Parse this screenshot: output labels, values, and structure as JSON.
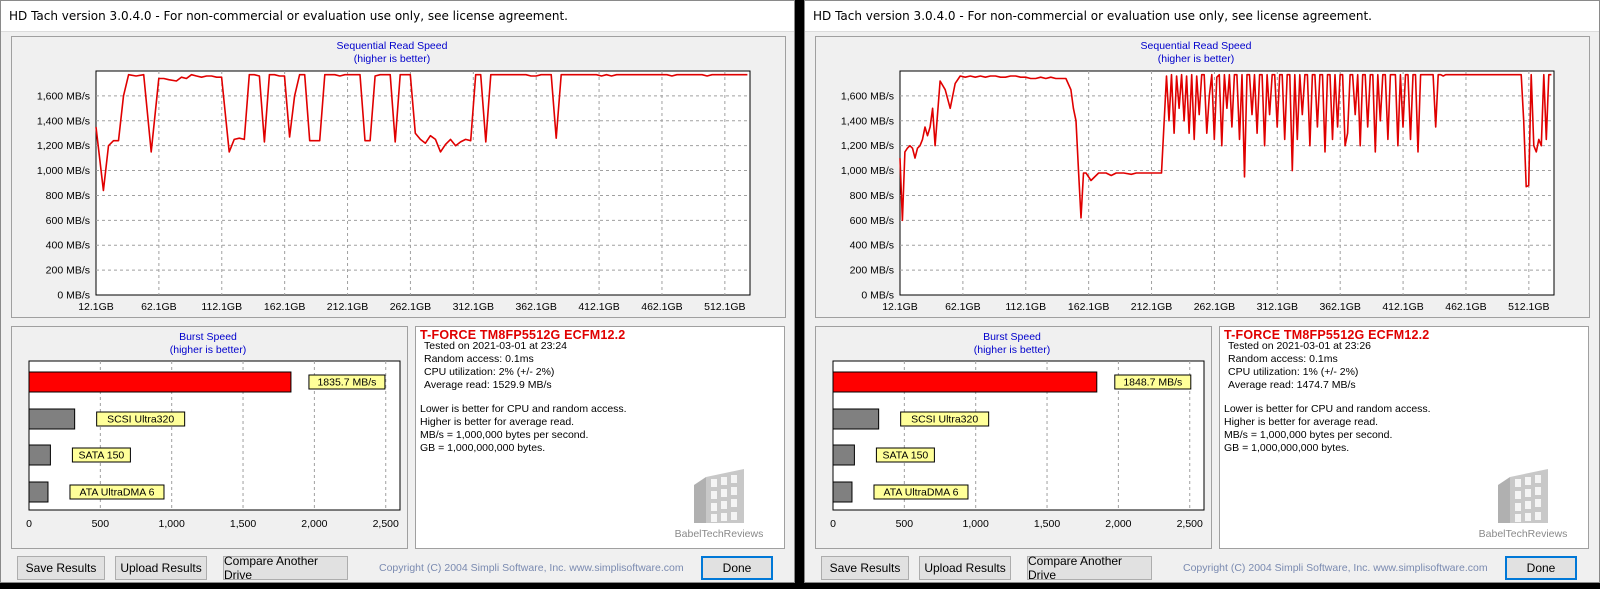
{
  "windows": [
    {
      "title": "HD Tach version 3.0.4.0  - For non-commercial or evaluation use only, see license agreement.",
      "seq": {
        "title": "Sequential Read Speed",
        "subtitle": "(higher is better)",
        "y_ticks": [
          "0 MB/s",
          "200 MB/s",
          "400 MB/s",
          "600 MB/s",
          "800 MB/s",
          "1,000 MB/s",
          "1,200 MB/s",
          "1,400 MB/s",
          "1,600 MB/s"
        ],
        "x_ticks": [
          "12.1GB",
          "62.1GB",
          "112.1GB",
          "162.1GB",
          "212.1GB",
          "262.1GB",
          "312.1GB",
          "362.1GB",
          "412.1GB",
          "462.1GB",
          "512.1GB"
        ]
      },
      "burst": {
        "title": "Burst Speed",
        "subtitle": "(higher is better)",
        "x_ticks": [
          "0",
          "500",
          "1,000",
          "1,500",
          "2,000",
          "2,500"
        ],
        "drive_label": "1835.7 MB/s",
        "ref_labels": [
          "SCSI Ultra320",
          "SATA 150",
          "ATA UltraDMA 6"
        ]
      },
      "info": {
        "drive_name": "T-FORCE TM8FP5512G ECFM12.2",
        "tested": "Tested on 2021-03-01 at 23:24",
        "random": "Random access: 0.1ms",
        "cpu": "CPU utilization: 2% (+/- 2%)",
        "avg": "Average read: 1529.9 MB/s",
        "note1": "Lower is better for CPU and random access.",
        "note2": "Higher is better for average read.",
        "note3": "MB/s = 1,000,000 bytes per second.",
        "note4": "GB = 1,000,000,000 bytes.",
        "watermark": "BabelTechReviews"
      },
      "buttons": {
        "save": "Save Results",
        "upload": "Upload Results",
        "compare": "Compare Another Drive",
        "done": "Done"
      },
      "copyright": "Copyright (C) 2004 Simpli Software, Inc. www.simplisoftware.com"
    },
    {
      "title": "HD Tach version 3.0.4.0  - For non-commercial or evaluation use only, see license agreement.",
      "seq": {
        "title": "Sequential Read Speed",
        "subtitle": "(higher is better)",
        "y_ticks": [
          "0 MB/s",
          "200 MB/s",
          "400 MB/s",
          "600 MB/s",
          "800 MB/s",
          "1,000 MB/s",
          "1,200 MB/s",
          "1,400 MB/s",
          "1,600 MB/s"
        ],
        "x_ticks": [
          "12.1GB",
          "62.1GB",
          "112.1GB",
          "162.1GB",
          "212.1GB",
          "262.1GB",
          "312.1GB",
          "362.1GB",
          "412.1GB",
          "462.1GB",
          "512.1GB"
        ]
      },
      "burst": {
        "title": "Burst Speed",
        "subtitle": "(higher is better)",
        "x_ticks": [
          "0",
          "500",
          "1,000",
          "1,500",
          "2,000",
          "2,500"
        ],
        "drive_label": "1848.7 MB/s",
        "ref_labels": [
          "SCSI Ultra320",
          "SATA 150",
          "ATA UltraDMA 6"
        ]
      },
      "info": {
        "drive_name": "T-FORCE TM8FP5512G ECFM12.2",
        "tested": "Tested on 2021-03-01 at 23:26",
        "random": "Random access: 0.1ms",
        "cpu": "CPU utilization: 1% (+/- 2%)",
        "avg": "Average read: 1474.7 MB/s",
        "note1": "Lower is better for CPU and random access.",
        "note2": "Higher is better for average read.",
        "note3": "MB/s = 1,000,000 bytes per second.",
        "note4": "GB = 1,000,000,000 bytes.",
        "watermark": "BabelTechReviews"
      },
      "buttons": {
        "save": "Save Results",
        "upload": "Upload Results",
        "compare": "Compare Another Drive",
        "done": "Done"
      },
      "copyright": "Copyright (C) 2004 Simpli Software, Inc. www.simplisoftware.com"
    }
  ],
  "colors": {
    "series": "#e00000",
    "burst_drive": "#ff0000",
    "burst_ref": "#808080",
    "label_fill": "#ffff99",
    "chart_title": "#0000cc",
    "grid": "#a0a0a0"
  },
  "chart_data": [
    {
      "type": "line",
      "title": "Sequential Read Speed",
      "subtitle": "(higher is better)",
      "xlabel": "",
      "ylabel": "",
      "xlim": [
        12.1,
        532.1
      ],
      "ylim": [
        0,
        1800
      ],
      "y_unit": "MB/s",
      "x_unit": "GB",
      "grid": true,
      "series": [
        {
          "x": [
            12.1,
            18,
            22,
            26,
            30,
            34,
            38,
            44,
            50,
            56,
            62,
            66,
            70,
            76,
            80,
            84,
            88,
            92,
            96,
            100,
            104,
            108,
            112,
            118,
            122,
            126,
            130,
            134,
            138,
            142,
            146,
            150,
            154,
            158,
            162,
            166,
            170,
            174,
            178,
            182,
            186,
            190,
            194,
            198,
            202,
            206,
            210,
            214,
            218,
            222,
            226,
            230,
            234,
            238,
            242,
            246,
            250,
            254,
            258,
            262,
            266,
            270,
            274,
            278,
            282,
            286,
            290,
            294,
            298,
            302,
            306,
            310,
            314,
            318,
            322,
            326,
            330,
            334,
            338,
            342,
            346,
            350,
            354,
            358,
            362,
            366,
            370,
            374,
            378,
            382,
            386,
            390,
            394,
            398,
            402,
            406,
            410,
            414,
            418,
            422,
            426,
            430,
            434,
            438,
            442,
            446,
            450,
            454,
            458,
            462,
            466,
            470,
            474,
            478,
            482,
            486,
            490,
            494,
            498,
            502,
            506,
            510,
            514,
            518,
            522,
            526,
            530
          ],
          "y": [
            1350,
            840,
            1200,
            1240,
            1240,
            1600,
            1770,
            1760,
            1770,
            1150,
            1740,
            1740,
            1730,
            1720,
            1750,
            1740,
            1770,
            1760,
            1750,
            1760,
            1760,
            1750,
            1750,
            1150,
            1250,
            1260,
            1250,
            1770,
            1770,
            1760,
            1230,
            1770,
            1770,
            1760,
            1760,
            1270,
            1600,
            1770,
            1770,
            1240,
            1240,
            1240,
            1770,
            1770,
            1770,
            1760,
            1770,
            1770,
            1770,
            1770,
            1240,
            1240,
            1760,
            1770,
            1770,
            1770,
            1230,
            1770,
            1770,
            1770,
            1300,
            1250,
            1220,
            1280,
            1250,
            1150,
            1210,
            1250,
            1200,
            1230,
            1250,
            1240,
            1770,
            1770,
            1230,
            1770,
            1770,
            1770,
            1770,
            1770,
            1770,
            1770,
            1770,
            1760,
            1760,
            1770,
            1770,
            1770,
            1260,
            1770,
            1770,
            1770,
            1770,
            1770,
            1770,
            1770,
            1770,
            1760,
            1770,
            1760,
            1770,
            1770,
            1770,
            1770,
            1770,
            1770,
            1770,
            1770,
            1770,
            1770,
            1770,
            1760,
            1770,
            1770,
            1770,
            1770,
            1770,
            1770,
            1760,
            1770,
            1770,
            1770,
            1770,
            1770,
            1770,
            1770,
            1770
          ]
        }
      ]
    },
    {
      "type": "bar",
      "title": "Burst Speed",
      "subtitle": "(higher is better)",
      "categories": [
        "T-FORCE TM8FP5512G",
        "SCSI Ultra320",
        "SATA 150",
        "ATA UltraDMA 6"
      ],
      "values": [
        1835.7,
        320,
        150,
        133
      ],
      "xlim": [
        0,
        2600
      ],
      "orientation": "horizontal"
    },
    {
      "type": "line",
      "title": "Sequential Read Speed",
      "subtitle": "(higher is better)",
      "xlabel": "",
      "ylabel": "",
      "xlim": [
        12.1,
        532.1
      ],
      "ylim": [
        0,
        1800
      ],
      "y_unit": "MB/s",
      "x_unit": "GB",
      "grid": true,
      "series": [
        {
          "x": [
            12.1,
            14,
            16,
            18,
            20,
            22,
            24,
            26,
            28,
            30,
            32,
            34,
            36,
            38,
            40,
            44,
            48,
            52,
            56,
            60,
            64,
            68,
            72,
            76,
            80,
            84,
            88,
            92,
            96,
            100,
            104,
            108,
            112,
            116,
            120,
            124,
            128,
            132,
            136,
            140,
            144,
            148,
            150,
            152,
            154,
            156,
            158,
            160,
            164,
            170,
            176,
            180,
            184,
            190,
            196,
            200,
            206,
            212,
            216,
            220,
            224,
            226,
            228,
            230,
            232,
            234,
            236,
            238,
            240,
            242,
            244,
            246,
            248,
            250,
            252,
            254,
            256,
            258,
            260,
            262,
            264,
            266,
            268,
            270,
            272,
            274,
            276,
            278,
            280,
            282,
            284,
            286,
            288,
            290,
            292,
            294,
            296,
            298,
            300,
            302,
            304,
            306,
            308,
            310,
            312,
            314,
            316,
            318,
            320,
            322,
            324,
            326,
            328,
            330,
            332,
            334,
            336,
            338,
            340,
            342,
            344,
            346,
            348,
            350,
            352,
            354,
            356,
            358,
            360,
            362,
            364,
            366,
            368,
            370,
            372,
            374,
            376,
            378,
            380,
            382,
            384,
            386,
            388,
            390,
            392,
            394,
            396,
            398,
            400,
            402,
            404,
            406,
            408,
            410,
            412,
            414,
            416,
            418,
            420,
            422,
            424,
            426,
            428,
            430,
            432,
            434,
            436,
            438,
            440,
            442,
            444,
            446,
            448,
            450,
            452,
            454,
            456,
            458,
            460,
            462,
            464,
            466,
            468,
            470,
            472,
            474,
            476,
            478,
            480,
            482,
            484,
            486,
            488,
            490,
            492,
            494,
            496,
            498,
            500,
            502,
            504,
            506,
            508,
            510,
            512,
            514,
            516,
            518,
            520,
            522,
            524,
            526,
            528,
            530
          ],
          "y": [
            1100,
            600,
            1150,
            1180,
            1200,
            1180,
            1100,
            1180,
            1200,
            1250,
            1350,
            1280,
            1350,
            1500,
            1200,
            1720,
            1650,
            1500,
            1700,
            1760,
            1750,
            1760,
            1750,
            1760,
            1750,
            1760,
            1760,
            1750,
            1750,
            1760,
            1760,
            1750,
            1750,
            1740,
            1740,
            1750,
            1740,
            1750,
            1740,
            1740,
            1740,
            1650,
            1500,
            1400,
            1000,
            620,
            980,
            980,
            920,
            980,
            980,
            960,
            980,
            980,
            970,
            980,
            980,
            980,
            980,
            980,
            1760,
            1400,
            1770,
            1300,
            1760,
            1500,
            1770,
            1400,
            1760,
            1300,
            1770,
            1250,
            1760,
            1450,
            1770,
            1770,
            1300,
            1600,
            1770,
            1250,
            1750,
            1770,
            1200,
            1770,
            1500,
            1770,
            1350,
            1770,
            1770,
            1250,
            1770,
            950,
            1770,
            1770,
            1450,
            1770,
            1300,
            1770,
            1770,
            1200,
            1770,
            1450,
            1770,
            1770,
            1350,
            1770,
            1770,
            1250,
            1770,
            1770,
            1000,
            1770,
            1250,
            1770,
            1450,
            1770,
            1770,
            1200,
            1770,
            1770,
            1350,
            1770,
            1770,
            1150,
            1770,
            1770,
            1250,
            1770,
            1350,
            1770,
            1770,
            1200,
            1300,
            1770,
            1770,
            1450,
            1770,
            1200,
            1770,
            1770,
            1350,
            1770,
            1770,
            1150,
            1770,
            1400,
            1770,
            1770,
            1250,
            1770,
            1770,
            1770,
            1200,
            1770,
            1350,
            1770,
            1770,
            1250,
            1770,
            1770,
            1150,
            1770,
            1770,
            1770,
            1770,
            1770,
            1770,
            1350,
            1770,
            1770,
            1760,
            1770,
            1770,
            1770,
            1770,
            1770,
            1770,
            1770,
            1770,
            1770,
            1770,
            1770,
            1770,
            1770,
            1770,
            1770,
            1770,
            1770,
            1770,
            1770,
            1770,
            1770,
            1770,
            1770,
            1770,
            1770,
            1770,
            1770,
            1770,
            1770,
            1770,
            1770,
            1400,
            870,
            880,
            1770,
            1200,
            1150,
            1250,
            1200,
            1770,
            1250,
            1770,
            1770
          ]
        }
      ]
    },
    {
      "type": "bar",
      "title": "Burst Speed",
      "subtitle": "(higher is better)",
      "categories": [
        "T-FORCE TM8FP5512G",
        "SCSI Ultra320",
        "SATA 150",
        "ATA UltraDMA 6"
      ],
      "values": [
        1848.7,
        320,
        150,
        133
      ],
      "xlim": [
        0,
        2600
      ],
      "orientation": "horizontal"
    }
  ]
}
